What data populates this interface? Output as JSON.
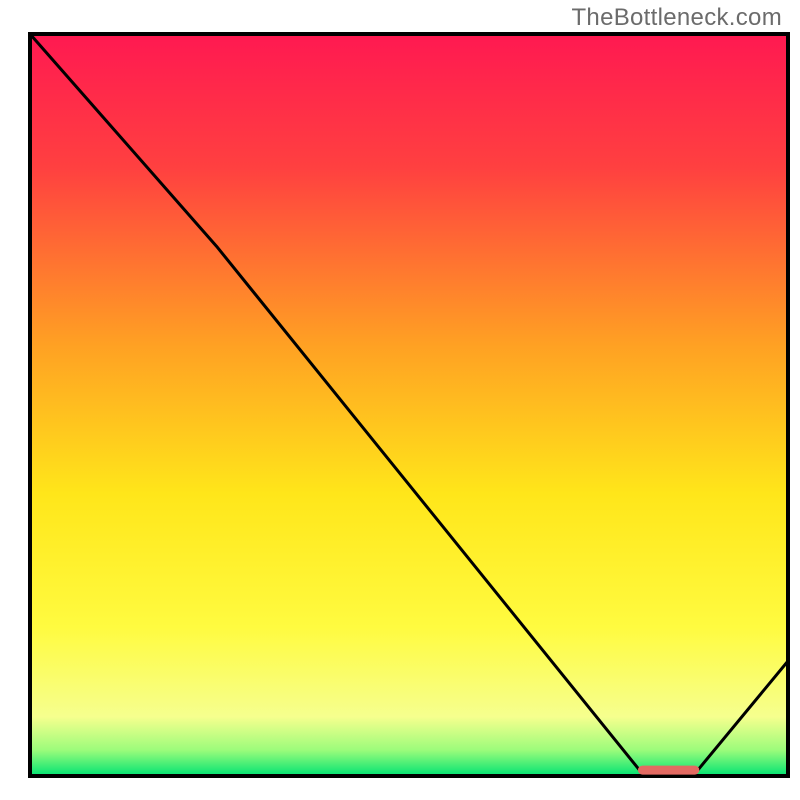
{
  "watermark": "TheBottleneck.com",
  "chart_data": {
    "type": "line",
    "x": [
      0,
      0.246,
      0.808,
      0.842,
      0.877,
      1.0
    ],
    "y": [
      1.0,
      0.714,
      0.003,
      0.0,
      0.003,
      0.155
    ],
    "xlabel": "",
    "ylabel": "",
    "xlim": [
      0,
      1
    ],
    "ylim": [
      0,
      1
    ],
    "annotations": [],
    "marker_segment": {
      "x0": 0.808,
      "x1": 0.877,
      "y": 0.008
    },
    "gradient": {
      "type": "vertical",
      "stops": [
        {
          "pos": 0.0,
          "hex": "#ff1951"
        },
        {
          "pos": 0.18,
          "hex": "#ff4040"
        },
        {
          "pos": 0.42,
          "hex": "#ffa123"
        },
        {
          "pos": 0.62,
          "hex": "#ffe61a"
        },
        {
          "pos": 0.8,
          "hex": "#fffb40"
        },
        {
          "pos": 0.92,
          "hex": "#f6ff8e"
        },
        {
          "pos": 0.965,
          "hex": "#9cfc7b"
        },
        {
          "pos": 1.0,
          "hex": "#00e373"
        }
      ]
    }
  }
}
